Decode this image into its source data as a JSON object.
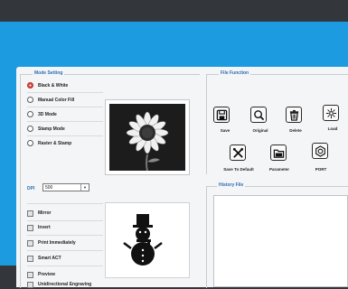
{
  "mode_setting": {
    "title": "Mode Setting",
    "options": [
      {
        "label": "Black & White",
        "selected": true
      },
      {
        "label": "Manual Color Fill",
        "selected": false
      },
      {
        "label": "3D Mode",
        "selected": false
      },
      {
        "label": "Stamp Mode",
        "selected": false
      },
      {
        "label": "Raster & Stamp",
        "selected": false
      }
    ]
  },
  "dpi": {
    "label": "DPI",
    "value": "500"
  },
  "checkboxes": [
    {
      "label": "Mirror"
    },
    {
      "label": "Invert"
    },
    {
      "label": "Print Immediately"
    },
    {
      "label": "Smart ACT"
    },
    {
      "label": "Preview"
    },
    {
      "label": "Unidirectional Engraving"
    }
  ],
  "file_function": {
    "title": "File Function",
    "buttons": [
      {
        "label": "Save",
        "icon": "floppy-icon"
      },
      {
        "label": "Original",
        "icon": "magnifier-icon"
      },
      {
        "label": "Delete",
        "icon": "trash-icon"
      },
      {
        "label": "Load",
        "icon": "burst-icon"
      },
      {
        "label": "Save To Default",
        "icon": "tools-icon"
      },
      {
        "label": "Parameter",
        "icon": "folder-icon"
      },
      {
        "label": "PORT",
        "icon": "port-icon"
      }
    ]
  },
  "history": {
    "title": "History File"
  },
  "colors": {
    "frame": "#1d9be0",
    "panel": "#f4f5f6",
    "accent_text": "#2f6db5"
  }
}
